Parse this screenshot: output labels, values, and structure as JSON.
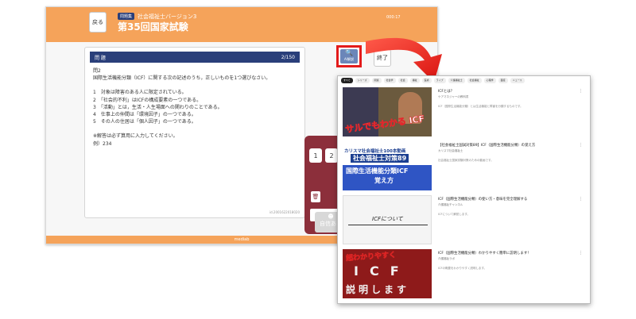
{
  "app": {
    "back_label": "戻る",
    "badge": "問題集",
    "subtitle": "社会福祉士バージョン3",
    "exam_title": "第35回国家試験",
    "timer": "000:17",
    "footer": "mediab",
    "ai_label": "AI解説",
    "end_label": "終了",
    "confident_label": "自信あり",
    "keys": [
      "1",
      "2"
    ]
  },
  "question": {
    "header_label": "問 題",
    "counter": "2/150",
    "number": "問2",
    "prompt": "国際生活機能分類（ICF）に関する次の記述のうち，正しいものを1つ選びなさい。",
    "options": [
      "1　対象は障害のある人に限定されている。",
      "2　「社会的不利」はICFの構成要素の一つである。",
      "3　「活動」とは，生活・人生場面への関わりのことである。",
      "4　仕事上の仲間は「環境因子」の一つである。",
      "5　その人の住居は「個人因子」の一つである。"
    ],
    "note": "※解答は必ず算用に入力してください。",
    "example": "例）234",
    "id": "id.2001622018020"
  },
  "youtube": {
    "chips": [
      "すべて",
      "シリーズ",
      "関連",
      "社会学",
      "社会",
      "福祉",
      "医療",
      "ライブ",
      "介護福祉士",
      "社会福祉",
      "心理学",
      "面接",
      "ニュース"
    ],
    "videos": [
      {
        "title": "ICFとは？",
        "channel": "ケアマネジャーの教科書",
        "desc": "ICF（国際生活機能分類）とは生活機能と障害を分類するものです。",
        "thumb": [
          "サルでもわかる ICF"
        ]
      },
      {
        "title": "【社会福祉士国試対策89】ICF（国際生活機能分類）の覚え方",
        "channel": "カリスマ社会福祉士",
        "desc": "社会福祉士国家試験対策のための動画です。",
        "thumb": [
          "カリスマ社会福祉士100本動画",
          "社会福祉士対策89",
          "国際生活機能分類ICF",
          "覚え方"
        ]
      },
      {
        "title": "ICF（国際生活機能分類）の使い方・意味を完全理解する",
        "channel": "介護福祉チャンネル",
        "desc": "ICFについて解説します。",
        "thumb": [
          "ICFについて"
        ]
      },
      {
        "title": "ICF（国際生活機能分類）わかりやすく簡単に説明します！",
        "channel": "介護福祉ラボ",
        "desc": "ICFの概要をわかりやすく説明します。",
        "thumb": [
          "超わかりやすく",
          "ICF",
          "説明します"
        ]
      }
    ]
  },
  "colors": {
    "accent": "#f5a35a",
    "navy": "#2a3f7a",
    "highlight": "#e31b1b",
    "keypad": "#8c2f3b"
  }
}
